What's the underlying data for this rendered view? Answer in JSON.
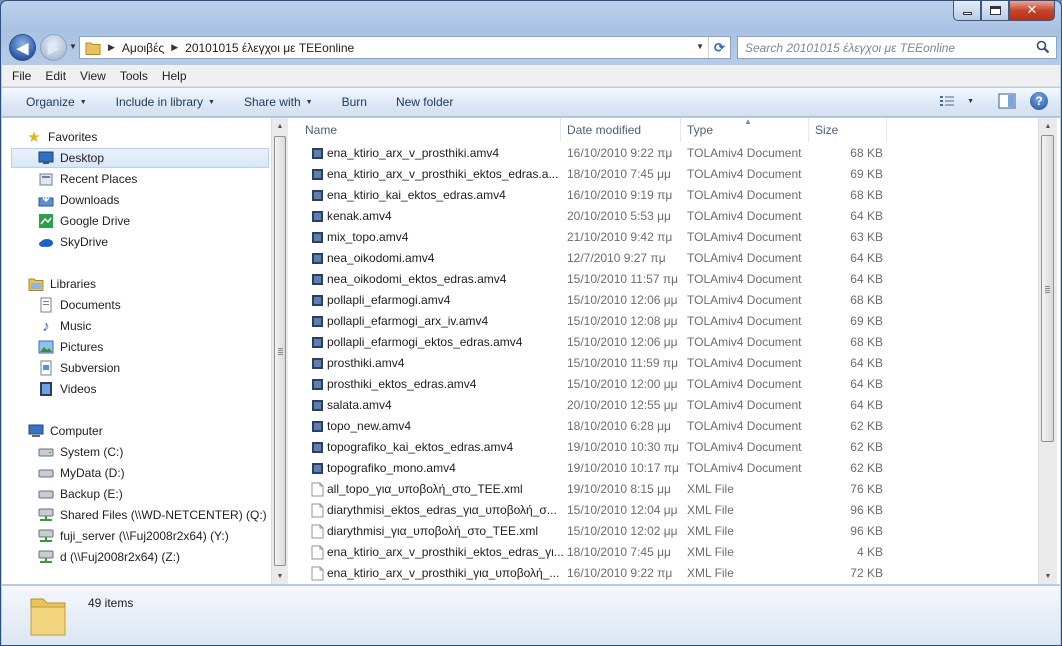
{
  "window": {
    "controls": [
      "minimize-icon",
      "maximize-icon",
      "close-icon"
    ]
  },
  "address": {
    "crumbs": [
      "Αμοιβές",
      "20101015 έλεγχοι με TEEonline"
    ]
  },
  "search": {
    "placeholder": "Search 20101015 έλεγχοι με TEEonline"
  },
  "menu": [
    "File",
    "Edit",
    "View",
    "Tools",
    "Help"
  ],
  "commands": {
    "organize": "Organize",
    "include": "Include in library",
    "share": "Share with",
    "burn": "Burn",
    "new_folder": "New folder"
  },
  "nav": {
    "favorites": {
      "label": "Favorites",
      "items": [
        {
          "label": "Desktop",
          "icon": "desktop-icon"
        },
        {
          "label": "Recent Places",
          "icon": "recent-places-icon"
        },
        {
          "label": "Downloads",
          "icon": "downloads-icon"
        },
        {
          "label": "Google Drive",
          "icon": "google-drive-icon"
        },
        {
          "label": "SkyDrive",
          "icon": "skydrive-icon"
        }
      ]
    },
    "libraries": {
      "label": "Libraries",
      "items": [
        {
          "label": "Documents",
          "icon": "documents-icon"
        },
        {
          "label": "Music",
          "icon": "music-icon"
        },
        {
          "label": "Pictures",
          "icon": "pictures-icon"
        },
        {
          "label": "Subversion",
          "icon": "subversion-icon"
        },
        {
          "label": "Videos",
          "icon": "videos-icon"
        }
      ]
    },
    "computer": {
      "label": "Computer",
      "items": [
        {
          "label": "System (C:)",
          "icon": "drive-icon"
        },
        {
          "label": "MyData (D:)",
          "icon": "drive-icon"
        },
        {
          "label": "Backup (E:)",
          "icon": "drive-icon"
        },
        {
          "label": "Shared Files (\\\\WD-NETCENTER) (Q:)",
          "icon": "network-drive-icon"
        },
        {
          "label": "fuji_server (\\\\Fuj2008r2x64) (Y:)",
          "icon": "network-drive-icon"
        },
        {
          "label": "d (\\\\Fuj2008r2x64) (Z:)",
          "icon": "network-drive-icon"
        }
      ]
    }
  },
  "columns": {
    "name": "Name",
    "date": "Date modified",
    "type": "Type",
    "size": "Size"
  },
  "files": [
    {
      "name": "ena_ktirio_arx_v_prosthiki.amv4",
      "date": "16/10/2010 9:22 πμ",
      "type": "TOLAmiv4 Document",
      "size": "68 KB"
    },
    {
      "name": "ena_ktirio_arx_v_prosthiki_ektos_edras.a...",
      "date": "18/10/2010 7:45 μμ",
      "type": "TOLAmiv4 Document",
      "size": "69 KB"
    },
    {
      "name": "ena_ktirio_kai_ektos_edras.amv4",
      "date": "16/10/2010 9:19 πμ",
      "type": "TOLAmiv4 Document",
      "size": "68 KB"
    },
    {
      "name": "kenak.amv4",
      "date": "20/10/2010 5:53 μμ",
      "type": "TOLAmiv4 Document",
      "size": "64 KB"
    },
    {
      "name": "mix_topo.amv4",
      "date": "21/10/2010 9:42 πμ",
      "type": "TOLAmiv4 Document",
      "size": "63 KB"
    },
    {
      "name": "nea_oikodomi.amv4",
      "date": "12/7/2010 9:27 πμ",
      "type": "TOLAmiv4 Document",
      "size": "64 KB"
    },
    {
      "name": "nea_oikodomi_ektos_edras.amv4",
      "date": "15/10/2010 11:57 πμ",
      "type": "TOLAmiv4 Document",
      "size": "64 KB"
    },
    {
      "name": "pollapli_efarmogi.amv4",
      "date": "15/10/2010 12:06 μμ",
      "type": "TOLAmiv4 Document",
      "size": "68 KB"
    },
    {
      "name": "pollapli_efarmogi_arx_iv.amv4",
      "date": "15/10/2010 12:08 μμ",
      "type": "TOLAmiv4 Document",
      "size": "69 KB"
    },
    {
      "name": "pollapli_efarmogi_ektos_edras.amv4",
      "date": "15/10/2010 12:06 μμ",
      "type": "TOLAmiv4 Document",
      "size": "68 KB"
    },
    {
      "name": "prosthiki.amv4",
      "date": "15/10/2010 11:59 πμ",
      "type": "TOLAmiv4 Document",
      "size": "64 KB"
    },
    {
      "name": "prosthiki_ektos_edras.amv4",
      "date": "15/10/2010 12:00 μμ",
      "type": "TOLAmiv4 Document",
      "size": "64 KB"
    },
    {
      "name": "salata.amv4",
      "date": "20/10/2010 12:55 μμ",
      "type": "TOLAmiv4 Document",
      "size": "64 KB"
    },
    {
      "name": "topo_new.amv4",
      "date": "18/10/2010 6:28 μμ",
      "type": "TOLAmiv4 Document",
      "size": "62 KB"
    },
    {
      "name": "topografiko_kai_ektos_edras.amv4",
      "date": "19/10/2010 10:30 πμ",
      "type": "TOLAmiv4 Document",
      "size": "62 KB"
    },
    {
      "name": "topografiko_mono.amv4",
      "date": "19/10/2010 10:17 πμ",
      "type": "TOLAmiv4 Document",
      "size": "62 KB"
    },
    {
      "name": "all_topo_για_υποβολή_στο_TEE.xml",
      "date": "19/10/2010 8:15 μμ",
      "type": "XML File",
      "size": "76 KB"
    },
    {
      "name": "diarythmisi_ektos_edras_για_υποβολή_σ...",
      "date": "15/10/2010 12:04 μμ",
      "type": "XML File",
      "size": "96 KB"
    },
    {
      "name": "diarythmisi_για_υποβολή_στο_TEE.xml",
      "date": "15/10/2010 12:02 μμ",
      "type": "XML File",
      "size": "96 KB"
    },
    {
      "name": "ena_ktirio_arx_v_prosthiki_ektos_edras_γι...",
      "date": "18/10/2010 7:45 μμ",
      "type": "XML File",
      "size": "4 KB"
    },
    {
      "name": "ena_ktirio_arx_v_prosthiki_για_υποβολή_...",
      "date": "16/10/2010 9:22 πμ",
      "type": "XML File",
      "size": "72 KB"
    }
  ],
  "status": {
    "count": "49 items"
  }
}
